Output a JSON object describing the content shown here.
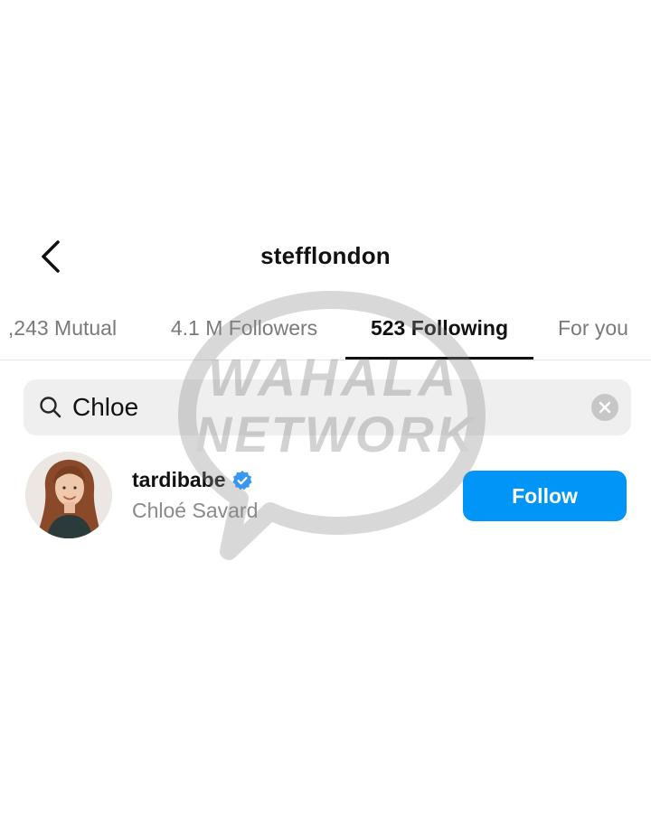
{
  "header": {
    "title": "stefflondon",
    "back_icon": "chevron-left-icon"
  },
  "tabs": [
    {
      "label": ",243 Mutual",
      "active": false
    },
    {
      "label": "4.1 M Followers",
      "active": false
    },
    {
      "label": "523 Following",
      "active": true
    },
    {
      "label": "For you",
      "active": false
    }
  ],
  "search": {
    "value": "Chloe",
    "icon": "search-icon",
    "clear_icon": "clear-icon"
  },
  "results": [
    {
      "username": "tardibabe",
      "verified": true,
      "full_name": "Chloé Savard",
      "follow_label": "Follow"
    }
  ],
  "watermark": {
    "line1": "WAHALA",
    "line2": "NETWORK"
  },
  "colors": {
    "follow_button": "#0095f6",
    "verified_badge": "#3897f0",
    "search_bg": "#efefef",
    "inactive_tab": "#7a7a7a"
  }
}
